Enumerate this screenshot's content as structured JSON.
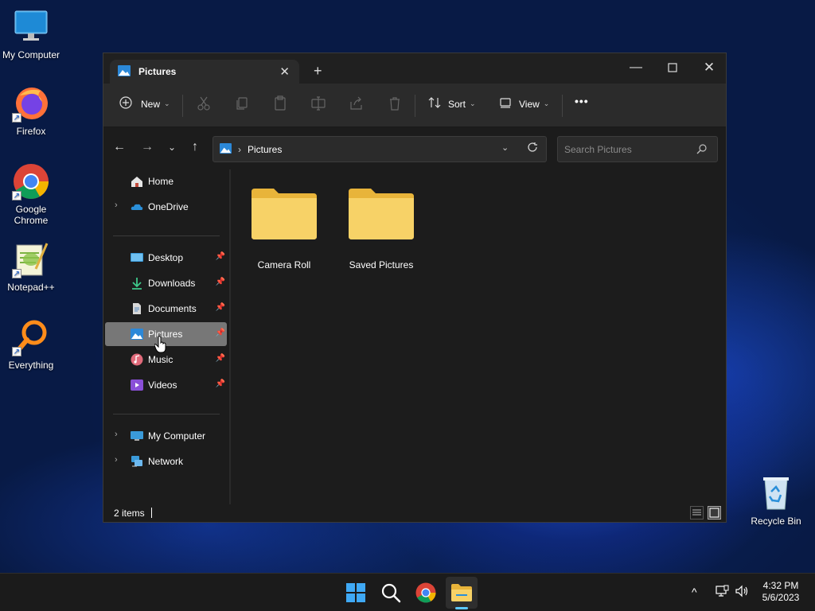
{
  "desktop": {
    "icons": [
      {
        "label": "My Computer",
        "icon": "monitor-icon"
      },
      {
        "label": "Firefox",
        "icon": "firefox-icon"
      },
      {
        "label": "Google Chrome",
        "icon": "chrome-icon"
      },
      {
        "label": "Notepad++",
        "icon": "notepadpp-icon"
      },
      {
        "label": "Everything",
        "icon": "everything-icon"
      },
      {
        "label": "Recycle Bin",
        "icon": "recycle-bin-icon"
      }
    ]
  },
  "window": {
    "tab_title": "Pictures",
    "toolbar": {
      "new_label": "New",
      "sort_label": "Sort",
      "view_label": "View",
      "more_label": "•••"
    },
    "address": {
      "separator": "›",
      "path": "Pictures",
      "search_placeholder": "Search Pictures"
    },
    "nav": {
      "top": [
        {
          "label": "Home",
          "icon": "home-icon"
        },
        {
          "label": "OneDrive",
          "icon": "onedrive-icon",
          "expandable": true
        }
      ],
      "pinned": [
        {
          "label": "Desktop",
          "icon": "desktop-folder-icon"
        },
        {
          "label": "Downloads",
          "icon": "downloads-icon"
        },
        {
          "label": "Documents",
          "icon": "documents-icon"
        },
        {
          "label": "Pictures",
          "icon": "pictures-icon",
          "selected": true
        },
        {
          "label": "Music",
          "icon": "music-icon"
        },
        {
          "label": "Videos",
          "icon": "videos-icon"
        }
      ],
      "bottom": [
        {
          "label": "My Computer",
          "icon": "computer-icon",
          "expandable": true
        },
        {
          "label": "Network",
          "icon": "network-icon",
          "expandable": true
        }
      ]
    },
    "folders": [
      {
        "name": "Camera Roll"
      },
      {
        "name": "Saved Pictures"
      }
    ],
    "status": {
      "item_count": "2 items"
    }
  },
  "taskbar": {
    "clock": {
      "time": "4:32 PM",
      "date": "5/6/2023"
    },
    "tray_chevron": "^"
  },
  "colors": {
    "accent": "#5cc8ff",
    "folder": "#f7d267",
    "selected_nav": "#777777"
  }
}
